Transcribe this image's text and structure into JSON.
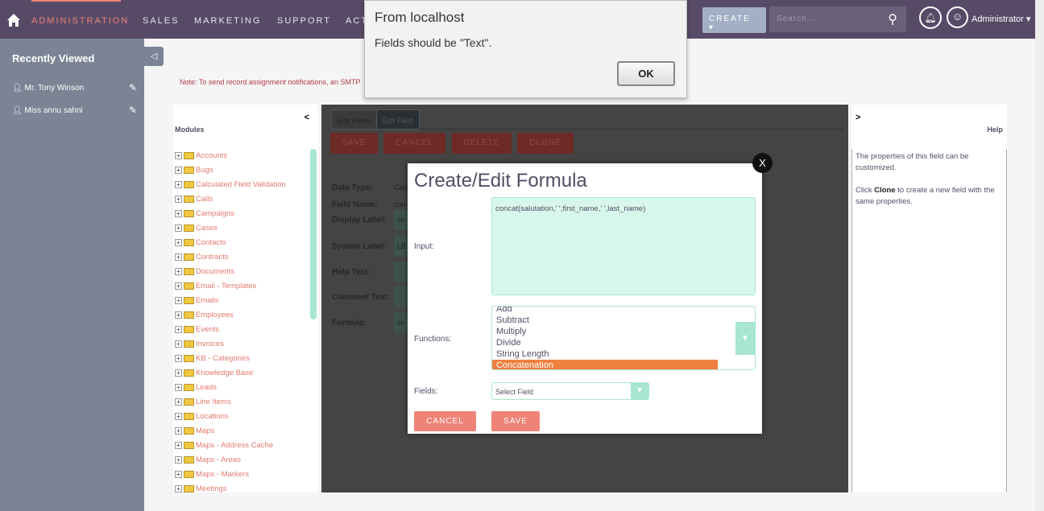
{
  "nav": {
    "items": [
      "ADMINISTRATION",
      "SALES",
      "MARKETING",
      "SUPPORT",
      "ACTIVITIES"
    ],
    "create": "CREATE",
    "search_placeholder": "Search...",
    "user": "Administrator"
  },
  "sidebar": {
    "title": "Recently Viewed",
    "items": [
      "Mr. Tony Winson",
      "Miss annu sahni"
    ]
  },
  "note": "Note: To send record assignment notifications, an SMTP",
  "modules": {
    "title": "Modules",
    "collapse": "<",
    "items": [
      "Accounts",
      "Bugs",
      "Calculated Field Validation",
      "Calls",
      "Campaigns",
      "Cases",
      "Contacts",
      "Contracts",
      "Documents",
      "Email - Templates",
      "Emails",
      "Employees",
      "Events",
      "Invoices",
      "KB - Categories",
      "Knowledge Base",
      "Leads",
      "Line Items",
      "Locations",
      "Maps",
      "Maps - Address Cache",
      "Maps - Areas",
      "Maps - Markers",
      "Meetings"
    ]
  },
  "editor": {
    "tabs": [
      "Edit Fields",
      "Edit Field"
    ],
    "buttons": [
      "SAVE",
      "CANCEL",
      "DELETE",
      "CLONE"
    ],
    "labels": [
      "Data Type:",
      "Field Name:",
      "Display Label:",
      "System Label:",
      "Help Text:",
      "Comment Text:",
      "Formula:"
    ],
    "values": [
      "Calc",
      "con",
      "co",
      "LB",
      "",
      "",
      "co"
    ]
  },
  "help": {
    "expand": ">",
    "title": "Help",
    "text1": "The properties of this field can be customized.",
    "text2_pre": "Click ",
    "text2_bold": "Clone",
    "text2_post": " to create a new field with the same properties."
  },
  "modal": {
    "title": "Create/Edit Formula",
    "close": "X",
    "input_label": "Input:",
    "input_value": "concat(salutation,' ',first_name,' ',last_name)",
    "functions_label": "Functions:",
    "functions": [
      "Add",
      "Subtract",
      "Multiply",
      "Divide",
      "String Length",
      "Concatenation"
    ],
    "selected_function": "Concatenation",
    "fields_label": "Fields:",
    "fields_value": "Select Field",
    "cancel": "CANCEL",
    "save": "SAVE"
  },
  "alert": {
    "title": "From localhost",
    "message": "Fields should be \"Text\".",
    "ok": "OK"
  },
  "colors": {
    "nav": "#574a66",
    "accent": "#f08377",
    "mint": "#a8e6cf",
    "selected": "#f08040"
  }
}
